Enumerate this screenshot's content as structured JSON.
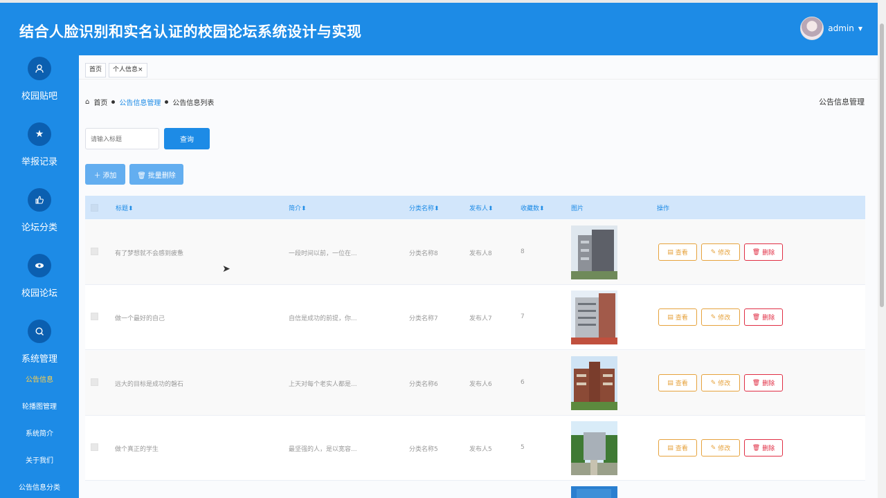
{
  "header": {
    "title": "结合人脸识别和实名认证的校园论坛系统设计与实现",
    "user": "admin"
  },
  "sidebar": {
    "items": [
      {
        "label": "校园贴吧",
        "icon": "user-icon"
      },
      {
        "label": "举报记录",
        "icon": "star-icon"
      },
      {
        "label": "论坛分类",
        "icon": "thumbs-up-icon"
      },
      {
        "label": "校园论坛",
        "icon": "eye-icon"
      },
      {
        "label": "系统管理",
        "icon": "search-icon"
      }
    ],
    "subitems": [
      "公告信息",
      "轮播图管理",
      "系统简介",
      "关于我们",
      "公告信息分类"
    ]
  },
  "tabs": [
    "首页",
    "个人信息"
  ],
  "breadcrumb": {
    "home": "首页",
    "section": "公告信息管理",
    "current": "公告信息列表",
    "right": "公告信息管理"
  },
  "search": {
    "placeholder": "请输入标题",
    "button": "查询"
  },
  "toolbar": {
    "add": "添加",
    "batch_delete": "批量删除"
  },
  "table": {
    "headers": {
      "title": "标题",
      "intro": "简介",
      "category": "分类名称",
      "publisher": "发布人",
      "favorites": "收藏数",
      "image": "图片",
      "actions": "操作"
    },
    "rows": [
      {
        "title": "有了梦想就不会感到疲惫",
        "intro": "一段时间以前，一位在...",
        "category": "分类名称8",
        "publisher": "发布人8",
        "favorites": "8"
      },
      {
        "title": "做一个最好的自己",
        "intro": "自信是成功的前提，你...",
        "category": "分类名称7",
        "publisher": "发布人7",
        "favorites": "7"
      },
      {
        "title": "远大的目标是成功的磐石",
        "intro": "上天对每个老实人都是...",
        "category": "分类名称6",
        "publisher": "发布人6",
        "favorites": "6"
      },
      {
        "title": "做个真正的学生",
        "intro": "最坚强的人，是以宽容...",
        "category": "分类名称5",
        "publisher": "发布人5",
        "favorites": "5"
      }
    ],
    "actions": {
      "view": "查看",
      "edit": "修改",
      "delete": "删除"
    }
  },
  "colors": {
    "primary": "#1d8be6",
    "warning": "#e6a23c",
    "danger": "#e02d43"
  }
}
